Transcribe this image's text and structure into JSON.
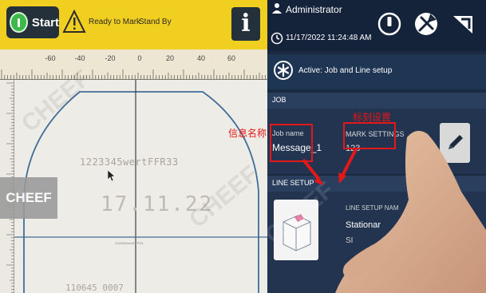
{
  "toolbar": {
    "start_label": "Start",
    "status_ready": "Ready to Mark",
    "status_standby": "Stand By",
    "info_label": "i"
  },
  "ruler": {
    "ticks": [
      "-60",
      "-40",
      "-20",
      "0",
      "20",
      "40",
      "60"
    ]
  },
  "canvas": {
    "text_line1": "1223345wertFFR33",
    "text_line2": "17.11.22",
    "text_small": "1223345wertFFR33",
    "text_bottom": "110645  0007"
  },
  "watermark": {
    "brand": "CHEEF"
  },
  "header": {
    "user": "Administrator",
    "datetime": "11/17/2022 11:24:48 AM"
  },
  "active": {
    "text": "Active: Job and Line setup"
  },
  "job": {
    "section_title": "JOB",
    "job_name_label": "Job name",
    "job_name_value": "Message_1",
    "mark_settings_label": "MARK SETTINGS",
    "mark_settings_value": "123"
  },
  "line_setup": {
    "section_title": "LINE SETUP",
    "name_label": "LINE SETUP NAM",
    "name_value": "Stationar",
    "extra": "SI"
  },
  "annotations": {
    "job_name_cn": "信息名称",
    "mark_settings_cn": "标刻设置"
  },
  "colors": {
    "toolbar_yellow": "#f1cf20",
    "start_green": "#3eb84a",
    "panel_navy": "#1b2a40",
    "annotation_red": "#e41818"
  }
}
